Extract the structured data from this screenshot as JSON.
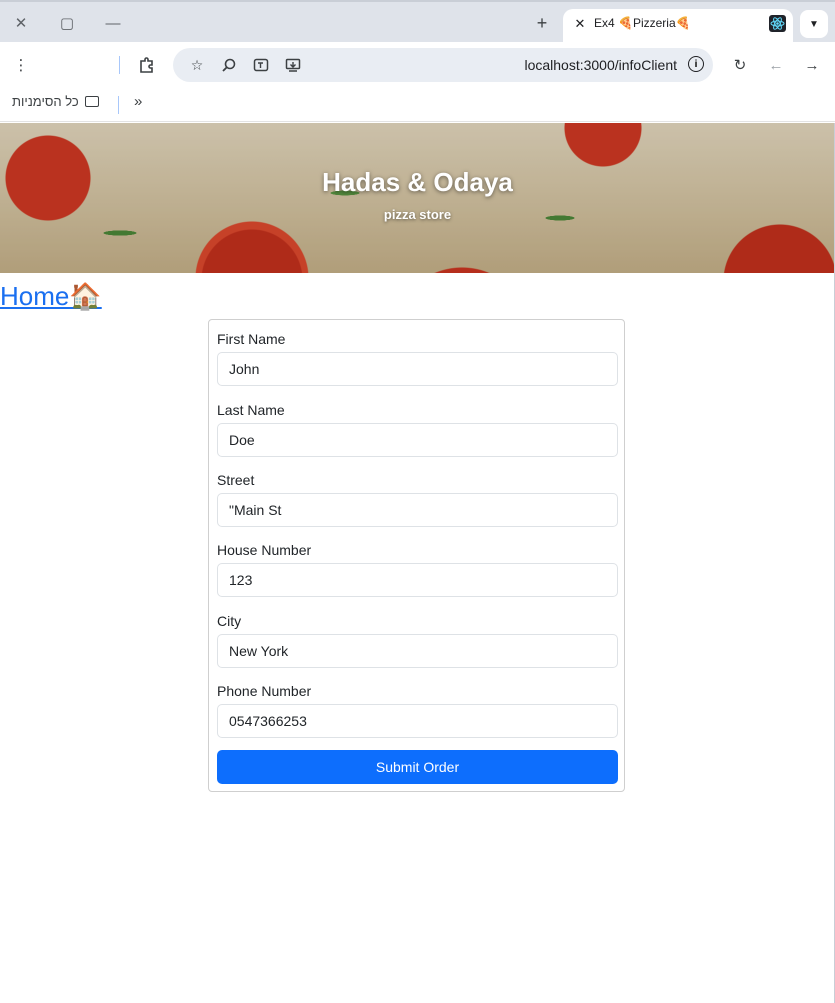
{
  "browser": {
    "tab_title": "Ex4 🍕Pizzeria🍕",
    "url": "localhost:3000/infoClient",
    "bookmarks_label": "כל הסימניות"
  },
  "header": {
    "title": "Hadas & Odaya",
    "subtitle": "pizza store"
  },
  "nav": {
    "home_label": "Home🏠"
  },
  "form": {
    "fields": [
      {
        "label": "First Name",
        "value": "John"
      },
      {
        "label": "Last Name",
        "value": "Doe"
      },
      {
        "label": "Street",
        "value": "\"Main St"
      },
      {
        "label": "House Number",
        "value": "123"
      },
      {
        "label": "City",
        "value": "New York"
      },
      {
        "label": "Phone Number",
        "value": "0547366253"
      }
    ],
    "submit_label": "Submit Order"
  },
  "colors": {
    "primary": "#0d6efd",
    "link": "#1a6ff0"
  }
}
